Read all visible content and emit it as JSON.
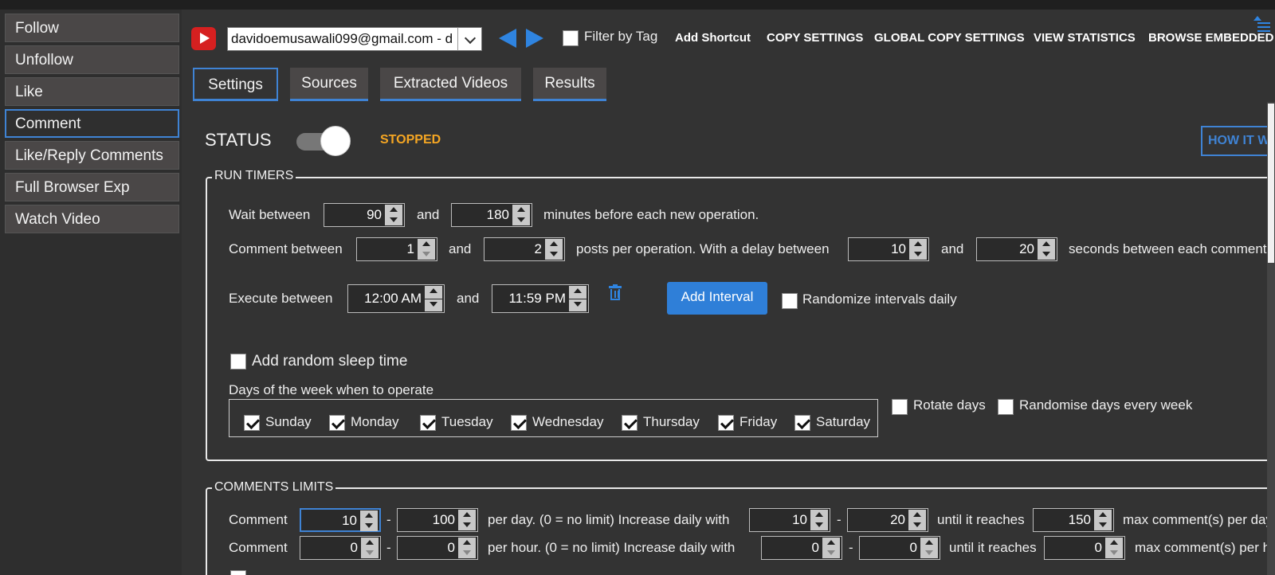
{
  "sidebar": {
    "items": [
      {
        "label": "Follow"
      },
      {
        "label": "Unfollow"
      },
      {
        "label": "Like"
      },
      {
        "label": "Comment",
        "active": true
      },
      {
        "label": "Like/Reply Comments"
      },
      {
        "label": "Full Browser Exp"
      },
      {
        "label": "Watch Video"
      }
    ]
  },
  "header": {
    "account": "davidoemusawali099@gmail.com - d",
    "filter_by_tag": "Filter by Tag",
    "links": {
      "add_shortcut": "Add Shortcut",
      "copy_settings": "COPY SETTINGS",
      "global_copy_settings": "GLOBAL COPY SETTINGS",
      "view_statistics": "VIEW STATISTICS",
      "browse_embedded": "BROWSE EMBEDDED"
    }
  },
  "tabs": [
    "Settings",
    "Sources",
    "Extracted Videos",
    "Results"
  ],
  "status": {
    "label": "STATUS",
    "value": "STOPPED",
    "how_it_works": "HOW IT W",
    "status_color": "#f5a623"
  },
  "run_timers": {
    "legend": "RUN TIMERS",
    "wait": {
      "label": "Wait between",
      "min": "90",
      "and": "and",
      "max": "180",
      "suffix": "minutes before each new operation."
    },
    "comment": {
      "label": "Comment between",
      "min": "1",
      "and": "and",
      "max": "2",
      "middle": "posts per operation. With a delay between",
      "delay_min": "10",
      "and2": "and",
      "delay_max": "20",
      "suffix": "seconds between each comment"
    },
    "execute": {
      "label": "Execute between",
      "start": "12:00 AM",
      "and": "and",
      "end": "11:59 PM"
    },
    "add_interval": "Add Interval",
    "randomize_intervals": "Randomize intervals daily",
    "add_random_sleep": "Add random sleep time",
    "days_label": "Days of the week when to operate",
    "days": [
      "Sunday",
      "Monday",
      "Tuesday",
      "Wednesday",
      "Thursday",
      "Friday",
      "Saturday"
    ],
    "rotate_days": "Rotate days",
    "randomise_days": "Randomise days every week"
  },
  "comments_limits": {
    "legend": "COMMENTS LIMITS",
    "per_day": {
      "label": "Comment",
      "min": "10",
      "dash": "-",
      "max": "100",
      "desc": "per day. (0 = no limit)  Increase daily with",
      "inc_min": "10",
      "dash2": "-",
      "inc_max": "20",
      "until": "until it reaches",
      "limit": "150",
      "suffix": "max comment(s) per day"
    },
    "per_hour": {
      "label": "Comment",
      "min": "0",
      "dash": "-",
      "max": "0",
      "desc": "per hour. (0 = no limit)  Increase daily with",
      "inc_min": "0",
      "dash2": "-",
      "inc_max": "0",
      "until": "until it reaches",
      "limit": "0",
      "suffix": "max comment(s) per h"
    }
  },
  "colors": {
    "accent": "#3f83d4",
    "button_blue": "#2f7fd8",
    "background": "#333333"
  }
}
